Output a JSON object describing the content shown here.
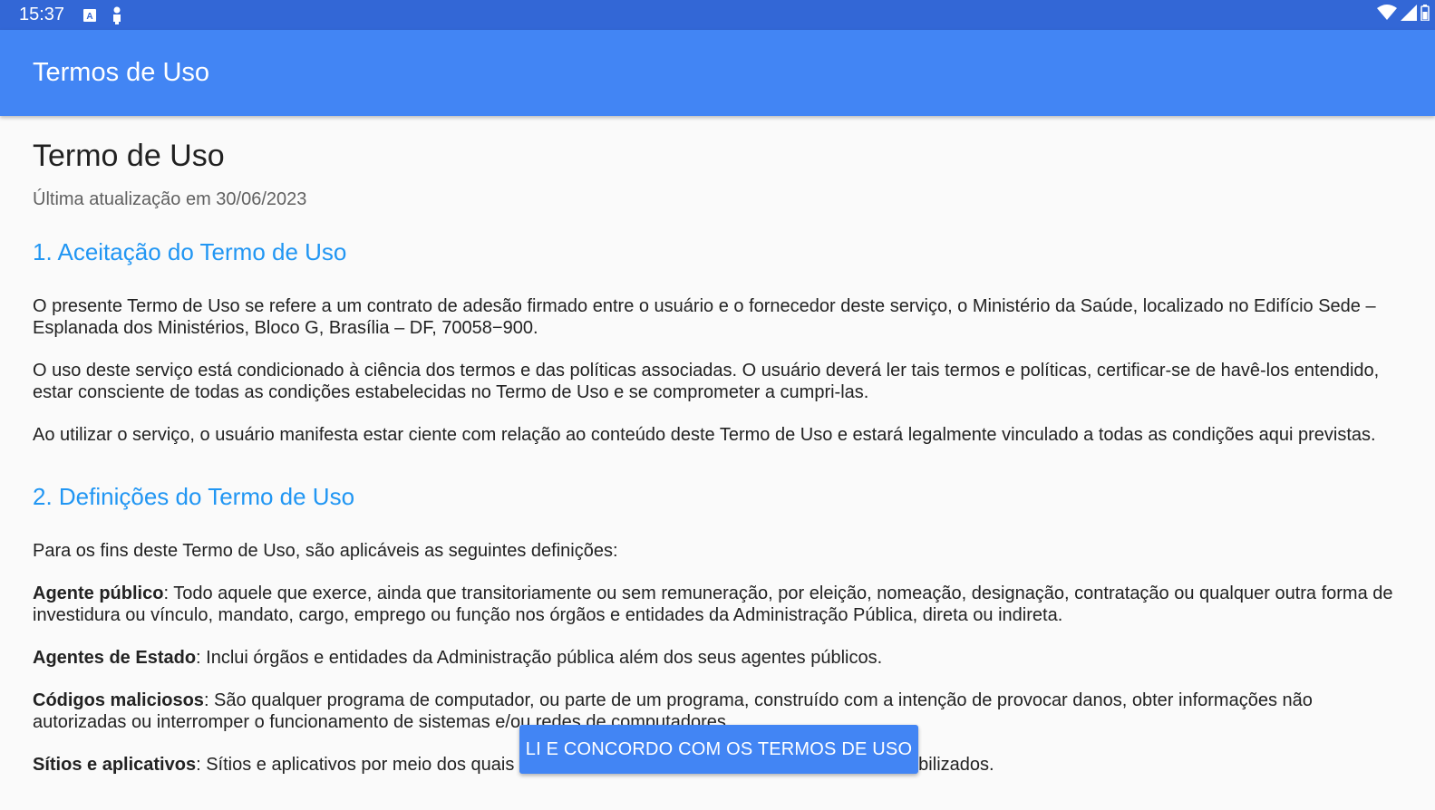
{
  "status_bar": {
    "time": "15:37",
    "icons_left": [
      "a-notification-icon",
      "person-notification-icon"
    ],
    "icons_right": [
      "wifi-icon",
      "signal-icon",
      "battery-icon"
    ],
    "color": "#3367d6"
  },
  "app_bar": {
    "title": "Termos de Uso",
    "color": "#4285f4"
  },
  "document": {
    "title": "Termo de Uso",
    "updated": "Última atualização em 30/06/2023",
    "sections": [
      {
        "title": "1. Aceitação do Termo de Uso",
        "paragraphs": [
          "O presente Termo de Uso se refere a um contrato de adesão firmado entre o usuário e o fornecedor deste serviço, o Ministério da Saúde, localizado no Edifício Sede – Esplanada dos Ministérios, Bloco G, Brasília – DF, 70058−900.",
          "O uso deste serviço está condicionado à ciência dos termos e das políticas associadas. O usuário deverá ler tais termos e políticas, certificar-se de havê-los entendido, estar consciente de todas as condições estabelecidas no Termo de Uso e se comprometer a cumpri-las.",
          "Ao utilizar o serviço, o usuário manifesta estar ciente com relação ao conteúdo deste Termo de Uso e estará legalmente vinculado a todas as condições aqui previstas."
        ]
      },
      {
        "title": "2. Definições do Termo de Uso",
        "intro": "Para os fins deste Termo de Uso, são aplicáveis as seguintes definições:",
        "definitions": [
          {
            "term": "Agente público",
            "text": ": Todo aquele que exerce, ainda que transitoriamente ou sem remuneração, por eleição, nomeação, designação, contratação ou qualquer outra forma de investidura ou vínculo, mandato, cargo, emprego ou função nos órgãos e entidades da Administração Pública, direta ou indireta."
          },
          {
            "term": "Agentes de Estado",
            "text": ": Inclui órgãos e entidades da Administração pública além dos seus agentes públicos."
          },
          {
            "term": "Códigos maliciosos",
            "text": ": São qualquer programa de computador, ou parte de um programa, construído com a intenção de provocar danos, obter informações não autorizadas ou interromper o funcionamento de sistemas e/ou redes de computadores."
          },
          {
            "term": "Sítios e aplicativos",
            "text": ": Sítios e aplicativos por meio dos quais o usuário acessa os serviços e conteúdos disponibilizados."
          }
        ]
      }
    ],
    "link_color": "#2196f3"
  },
  "accept_button": {
    "label": "LI E CONCORDO COM OS TERMOS DE USO",
    "color": "#4285f4"
  }
}
